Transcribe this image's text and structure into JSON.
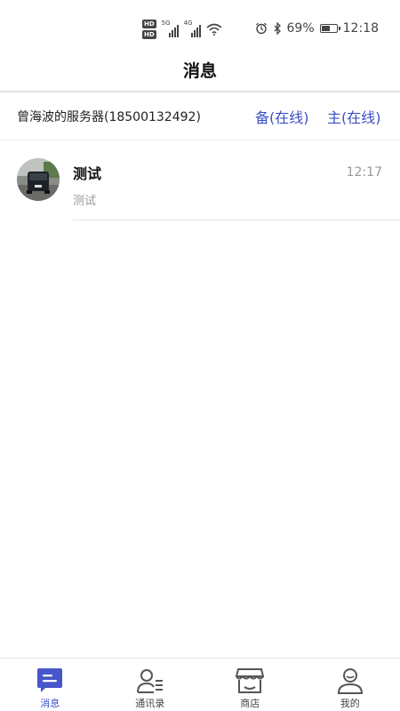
{
  "status_bar": {
    "sim1_label": "HD",
    "sim2_label": "HD",
    "network_1": "5G",
    "network_2": "4G",
    "battery_percent_text": "69%",
    "battery_level": 0.69,
    "time": "12:18",
    "icons": [
      "alarm-icon",
      "bluetooth-icon",
      "wifi-icon",
      "battery-icon"
    ]
  },
  "header": {
    "title": "消息"
  },
  "server": {
    "name": "曾海波的服务器(18500132492)",
    "backup_label": "备(在线)",
    "main_label": "主(在线)"
  },
  "chats": [
    {
      "name": "测试",
      "time": "12:17",
      "preview": "测试",
      "avatar": "car-photo"
    }
  ],
  "bottom_nav": {
    "items": [
      {
        "label": "消息",
        "icon": "message-icon",
        "active": true
      },
      {
        "label": "通讯录",
        "icon": "contacts-icon",
        "active": false
      },
      {
        "label": "商店",
        "icon": "store-icon",
        "active": false
      },
      {
        "label": "我的",
        "icon": "profile-icon",
        "active": false
      }
    ]
  },
  "colors": {
    "accent": "#3b4fc4",
    "text_primary": "#111111",
    "text_secondary": "#999999"
  }
}
